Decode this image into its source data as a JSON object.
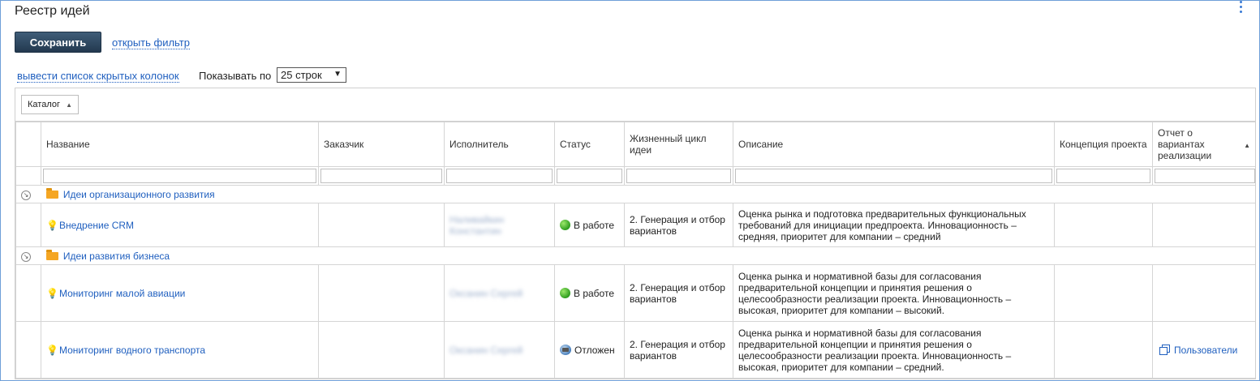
{
  "page": {
    "title": "Реестр идей"
  },
  "toolbar": {
    "save_label": "Сохранить",
    "open_filter_label": "открыть фильтр",
    "hidden_columns_label": "вывести список скрытых колонок",
    "show_per_label": "Показывать по",
    "rows_selected": "25 строк"
  },
  "grouping": {
    "chip_label": "Каталог"
  },
  "columns": {
    "name": "Название",
    "customer": "Заказчик",
    "executor": "Исполнитель",
    "status": "Статус",
    "lifecycle": "Жизненный цикл идеи",
    "description": "Описание",
    "concept": "Концепция проекта",
    "report": "Отчет о вариантах реализации"
  },
  "groups": [
    {
      "title": "Идеи организационного развития",
      "rows": [
        {
          "name": "Внедрение CRM",
          "customer": "",
          "executor": "Наливайкин Константин",
          "status": "В работе",
          "lifecycle": "2. Генерация и отбор вариантов",
          "description": "Оценка рынка и подготовка предварительных функциональных требований для инициации предпроекта. Инновационность – средняя, приоритет для компании – средний",
          "concept": "",
          "report": ""
        }
      ]
    },
    {
      "title": "Идеи развития бизнеса",
      "rows": [
        {
          "name": "Мониторинг малой авиации",
          "customer": "",
          "executor": "Оксанин Сергей",
          "status": "В работе",
          "lifecycle": "2. Генерация и отбор вариантов",
          "description": "Оценка рынка и нормативной базы для согласования предварительной концепции и принятия решения о целесообразности реализации проекта. Инновационность – высокая, приоритет для компании – высокий.",
          "concept": "",
          "report": ""
        },
        {
          "name": "Мониторинг водного транспорта",
          "customer": "",
          "executor": "Оксанин Сергей",
          "status": "Отложен",
          "lifecycle": "2. Генерация и отбор вариантов",
          "description": "Оценка рынка и нормативной базы для согласования предварительной концепции и принятия решения о целесообразности реализации проекта. Инновационность – высокая, приоритет для компании – средний.",
          "concept": "",
          "report": "Пользователи"
        }
      ]
    }
  ],
  "icons": {
    "kebab": "more-vertical-icon",
    "select_arrow": "triangle-down-icon",
    "chip_arrow": "triangle-up-icon",
    "expander": "expand-circle-icon",
    "folder": "folder-icon",
    "idea": "lightbulb-icon",
    "status_active": "green-circle-icon",
    "status_paused": "paused-icon",
    "report_link": "copy-icon"
  },
  "colors": {
    "link": "#1f5fbf",
    "save_button": "#2c4660",
    "frame_border": "#6f9fd8",
    "folder": "#f5a623"
  }
}
